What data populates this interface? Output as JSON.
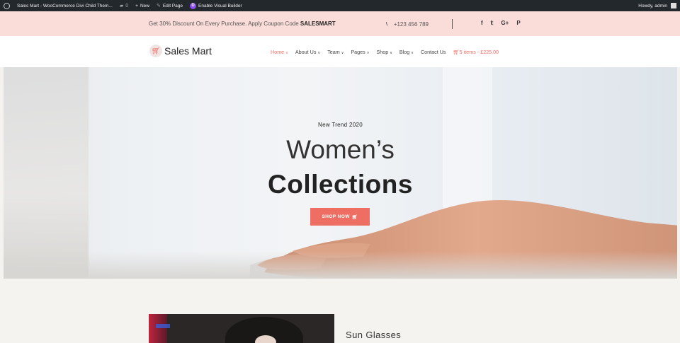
{
  "adminbar": {
    "site": "Sales Mart - WooCommerce Divi Child Them...",
    "comments": "0",
    "new": "New",
    "edit": "Edit Page",
    "builder": "Enable Visual Builder",
    "howdy": "Howdy, admin"
  },
  "topbar": {
    "promo_text": "Get 30% Discount On Every Purchase. Apply Coupon Code ",
    "coupon": "SALESMART",
    "phone": "+123 456 789",
    "social": [
      "f",
      "🐦",
      "G+",
      "P"
    ]
  },
  "header": {
    "logo": "Sales Mart",
    "nav": [
      {
        "label": "Home",
        "dropdown": true,
        "active": true
      },
      {
        "label": "About Us",
        "dropdown": true
      },
      {
        "label": "Team",
        "dropdown": true
      },
      {
        "label": "Pages",
        "dropdown": true
      },
      {
        "label": "Shop",
        "dropdown": true
      },
      {
        "label": "Blog",
        "dropdown": true
      },
      {
        "label": "Contact Us",
        "dropdown": false
      }
    ],
    "cart": "5 items - £225.00"
  },
  "hero": {
    "kicker": "New Trend 2020",
    "line1": "Women’s",
    "line2": "Collections",
    "button": "SHOP NOW"
  },
  "product": {
    "title": "Sun Glasses"
  },
  "colors": {
    "accent": "#ef6e63",
    "topbar_bg": "#fadcd9",
    "adminbar_bg": "#23282d"
  }
}
